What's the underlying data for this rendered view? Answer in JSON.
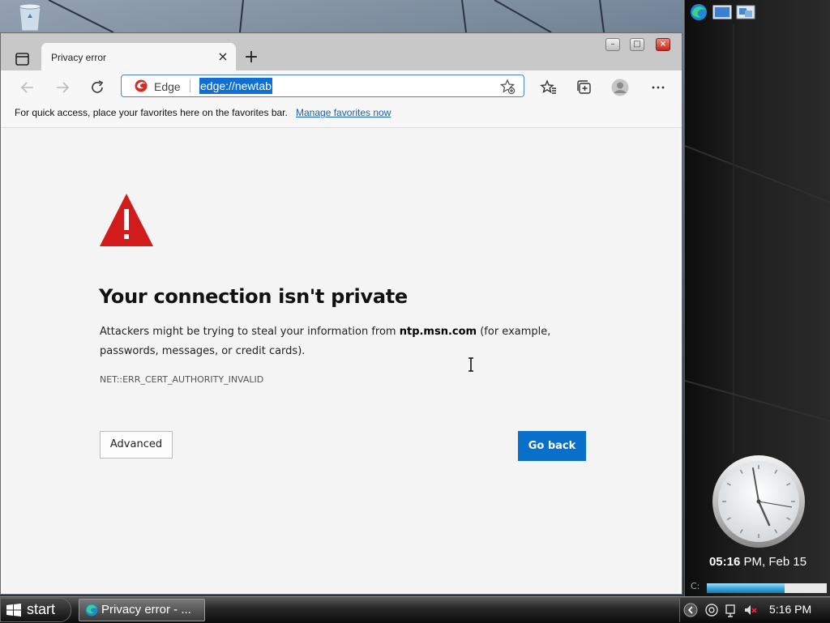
{
  "browser": {
    "tab": {
      "title": "Privacy error",
      "close_glyph": "×"
    },
    "new_tab_glyph": "+",
    "address": {
      "site_label": "Edge",
      "url": "edge://newtab"
    },
    "favorites_bar": {
      "message": "For quick access, place your favorites here on the favorites bar.",
      "link": "Manage favorites now"
    },
    "window_buttons": {
      "minimize": "–",
      "maximize": "□",
      "close": "×"
    }
  },
  "error_page": {
    "title": "Your connection isn't private",
    "body_prefix": "Attackers might be trying to steal your information from ",
    "host": "ntp.msn.com",
    "body_suffix": " (for example, passwords, messages, or credit cards).",
    "code": "NET::ERR_CERT_AUTHORITY_INVALID",
    "advanced_label": "Advanced",
    "go_back_label": "Go back",
    "warning_icon": "warning-triangle",
    "accent_color": "#0a6fc9",
    "warning_color": "#d21c1c"
  },
  "gadgets": {
    "clock": {
      "hour_bold": "05:16",
      "rest": " PM, Feb 15"
    },
    "drive": {
      "label": "C:",
      "used_fraction": 0.65
    }
  },
  "taskbar": {
    "start_label": "start",
    "task_label": "Privacy error - ...",
    "time": "5:16 PM"
  }
}
